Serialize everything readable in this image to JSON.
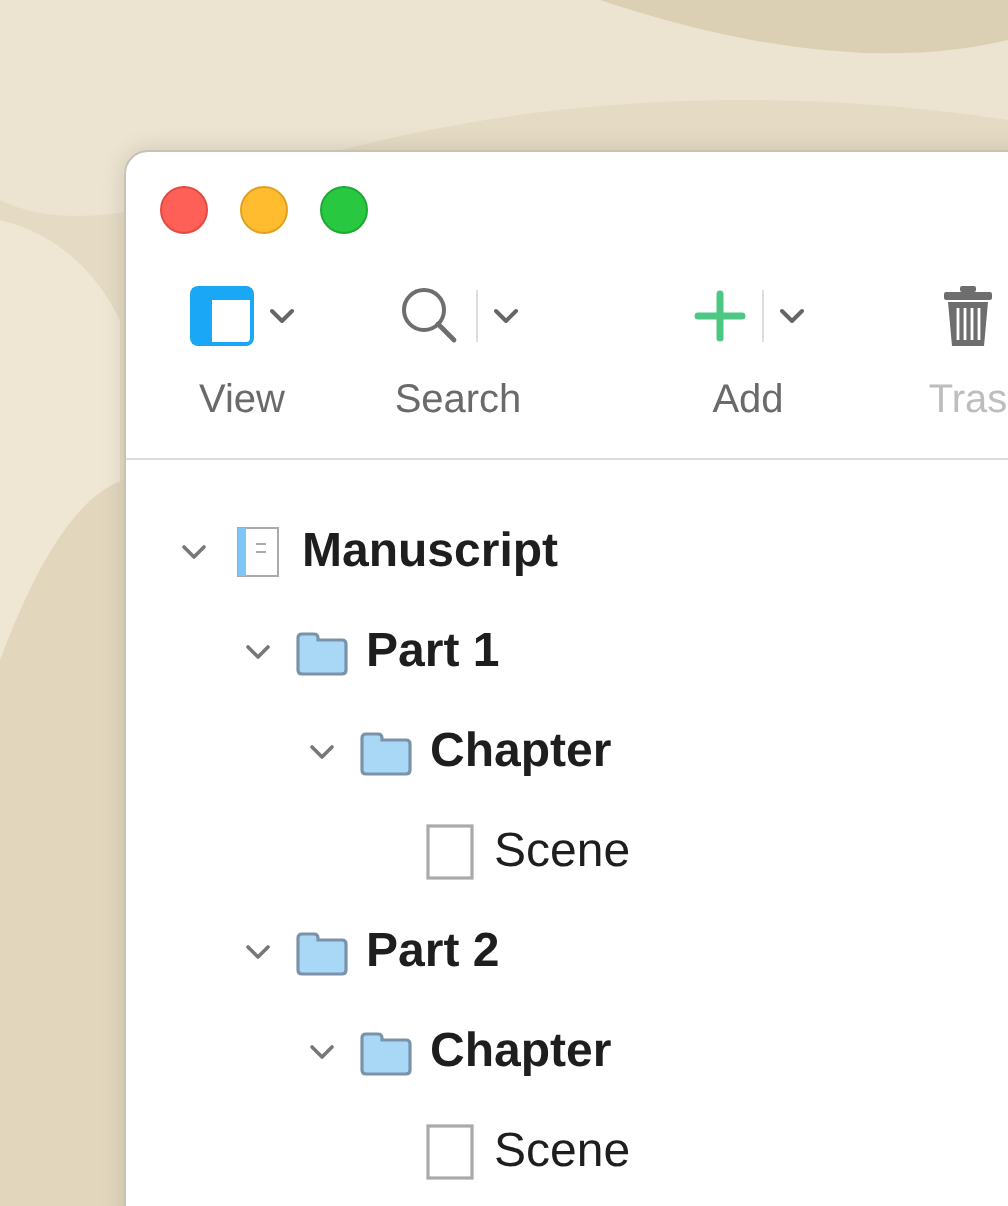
{
  "toolbar": [
    {
      "kind": "view",
      "label": "View",
      "disabled": false,
      "menu": true,
      "divider": false
    },
    {
      "kind": "search",
      "label": "Search",
      "disabled": false,
      "menu": true,
      "divider": true
    },
    {
      "kind": "add",
      "label": "Add",
      "disabled": false,
      "menu": true,
      "divider": true
    },
    {
      "kind": "trash",
      "label": "Tras",
      "disabled": true,
      "menu": false,
      "divider": false
    }
  ],
  "binder": [
    {
      "kind": "manuscript",
      "title": "Manuscript",
      "expanded": true,
      "children": [
        {
          "kind": "folder",
          "title": "Part 1",
          "expanded": true,
          "children": [
            {
              "kind": "folder",
              "title": "Chapter",
              "expanded": true,
              "children": [
                {
                  "kind": "document",
                  "title": "Scene"
                }
              ]
            }
          ]
        },
        {
          "kind": "folder",
          "title": "Part 2",
          "expanded": true,
          "children": [
            {
              "kind": "folder",
              "title": "Chapter",
              "expanded": true,
              "children": [
                {
                  "kind": "document",
                  "title": "Scene"
                }
              ]
            }
          ]
        }
      ]
    }
  ]
}
